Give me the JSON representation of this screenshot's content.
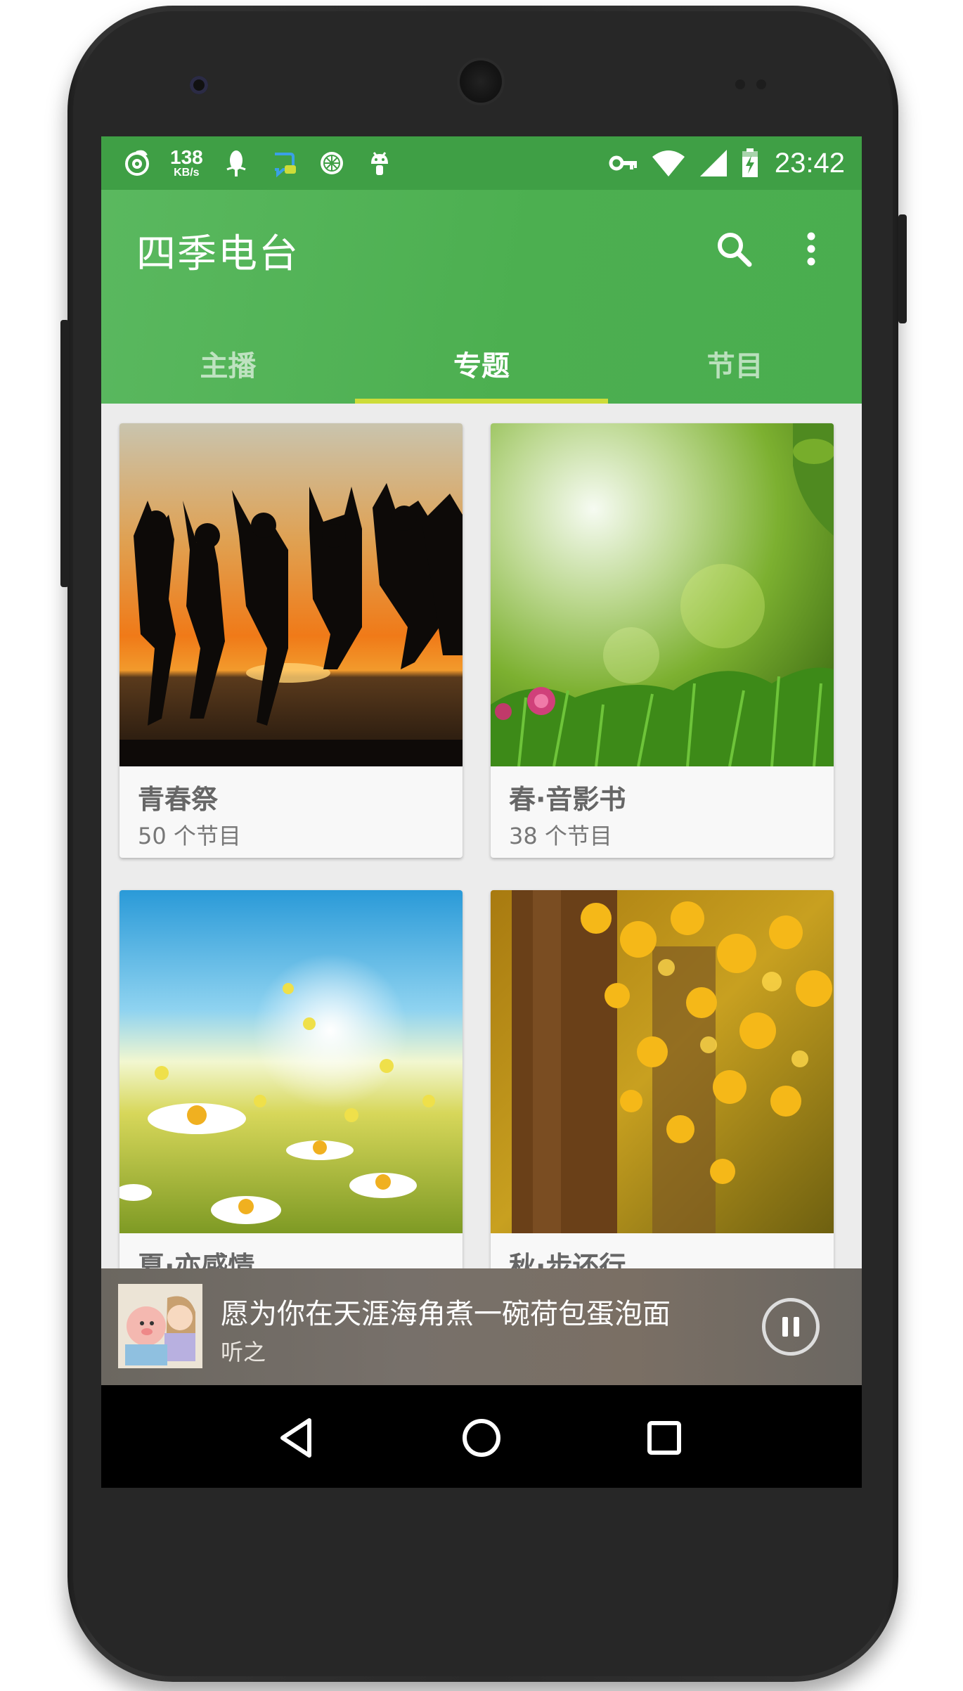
{
  "status_bar": {
    "speed_value": "138",
    "speed_unit": "KB/s",
    "time": "23:42"
  },
  "app_bar": {
    "title": "四季电台",
    "search_icon": "search-icon",
    "more_icon": "more-vert-icon"
  },
  "tabs": [
    {
      "label": "主播",
      "active": false
    },
    {
      "label": "专题",
      "active": true
    },
    {
      "label": "节目",
      "active": false
    }
  ],
  "cards": [
    {
      "title": "青春祭",
      "subtitle": "50 个节目",
      "image": "jumping-silhouettes-sunset"
    },
    {
      "title": "春·音影书",
      "subtitle": "38 个节目",
      "image": "green-spring-grass-flowers"
    },
    {
      "title": "夏·亦感情",
      "subtitle": "",
      "image": "daisy-field-sunny-sky"
    },
    {
      "title": "秋·步还行",
      "subtitle": "",
      "image": "autumn-yellow-tree"
    }
  ],
  "player": {
    "song": "愿为你在天涯海角煮一碗荷包蛋泡面",
    "artist": "听之",
    "state_icon": "pause-icon"
  },
  "nav_bar": {
    "back_icon": "back-icon",
    "home_icon": "home-icon",
    "recents_icon": "recents-icon"
  },
  "colors": {
    "primary": "#4caf50",
    "status_bar": "#3f9f45",
    "tab_indicator": "#cddc39"
  }
}
